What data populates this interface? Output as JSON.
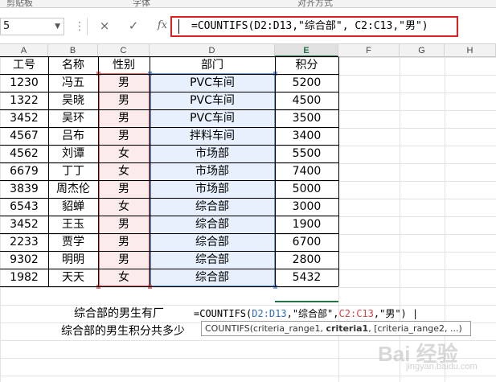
{
  "ribbon": {
    "group1": "剪贴板",
    "group2": "字体",
    "group3": "对齐方式"
  },
  "formula_bar": {
    "name_box": "5",
    "cancel_icon": "×",
    "enter_icon": "✓",
    "fx_label": "fx",
    "formula": "=COUNTIFS(D2:D13,\"综合部\", C2:C13,\"男\")"
  },
  "columns": [
    "A",
    "B",
    "C",
    "D",
    "E",
    "F",
    "G",
    "H"
  ],
  "active_column": "E",
  "table": {
    "headers": [
      "工号",
      "名称",
      "性别",
      "部门",
      "积分"
    ],
    "rows": [
      [
        "1230",
        "冯五",
        "男",
        "PVC车间",
        "5200"
      ],
      [
        "1322",
        "吴晓",
        "男",
        "PVC车间",
        "4500"
      ],
      [
        "3452",
        "吴环",
        "男",
        "PVC车间",
        "3500"
      ],
      [
        "4567",
        "吕布",
        "男",
        "拌料车间",
        "3400"
      ],
      [
        "4562",
        "刘谭",
        "女",
        "市场部",
        "5500"
      ],
      [
        "6679",
        "丁丁",
        "女",
        "市场部",
        "7400"
      ],
      [
        "3839",
        "周杰伦",
        "男",
        "市场部",
        "5000"
      ],
      [
        "6543",
        "貂蝉",
        "女",
        "综合部",
        "3000"
      ],
      [
        "3452",
        "王玉",
        "男",
        "综合部",
        "1900"
      ],
      [
        "2233",
        "贾学",
        "男",
        "综合部",
        "6700"
      ],
      [
        "9302",
        "明明",
        "男",
        "综合部",
        "2800"
      ],
      [
        "1982",
        "天天",
        "女",
        "综合部",
        "5432"
      ]
    ]
  },
  "notes": {
    "q1": "综合部的男生有厂",
    "q2": "综合部的男生积分共多少"
  },
  "inline_formula": {
    "prefix": "=COUNTIFS(",
    "range1": "D2:D13",
    "mid": ",\"综合部\",",
    "range2": "C2:C13",
    "suffix": ",\"男\")"
  },
  "tooltip": {
    "fn": "COUNTIFS(criteria_range1, ",
    "bold": "criteria1",
    "rest": ", [criteria_range2, ...)"
  },
  "watermark": {
    "main": "Bai 经验",
    "sub": "jingyan.baidu.com"
  },
  "colors": {
    "red_range": "#e46a6a",
    "blue_range": "#6f9de0",
    "accent": "#217346",
    "formula_border": "#e02020"
  }
}
